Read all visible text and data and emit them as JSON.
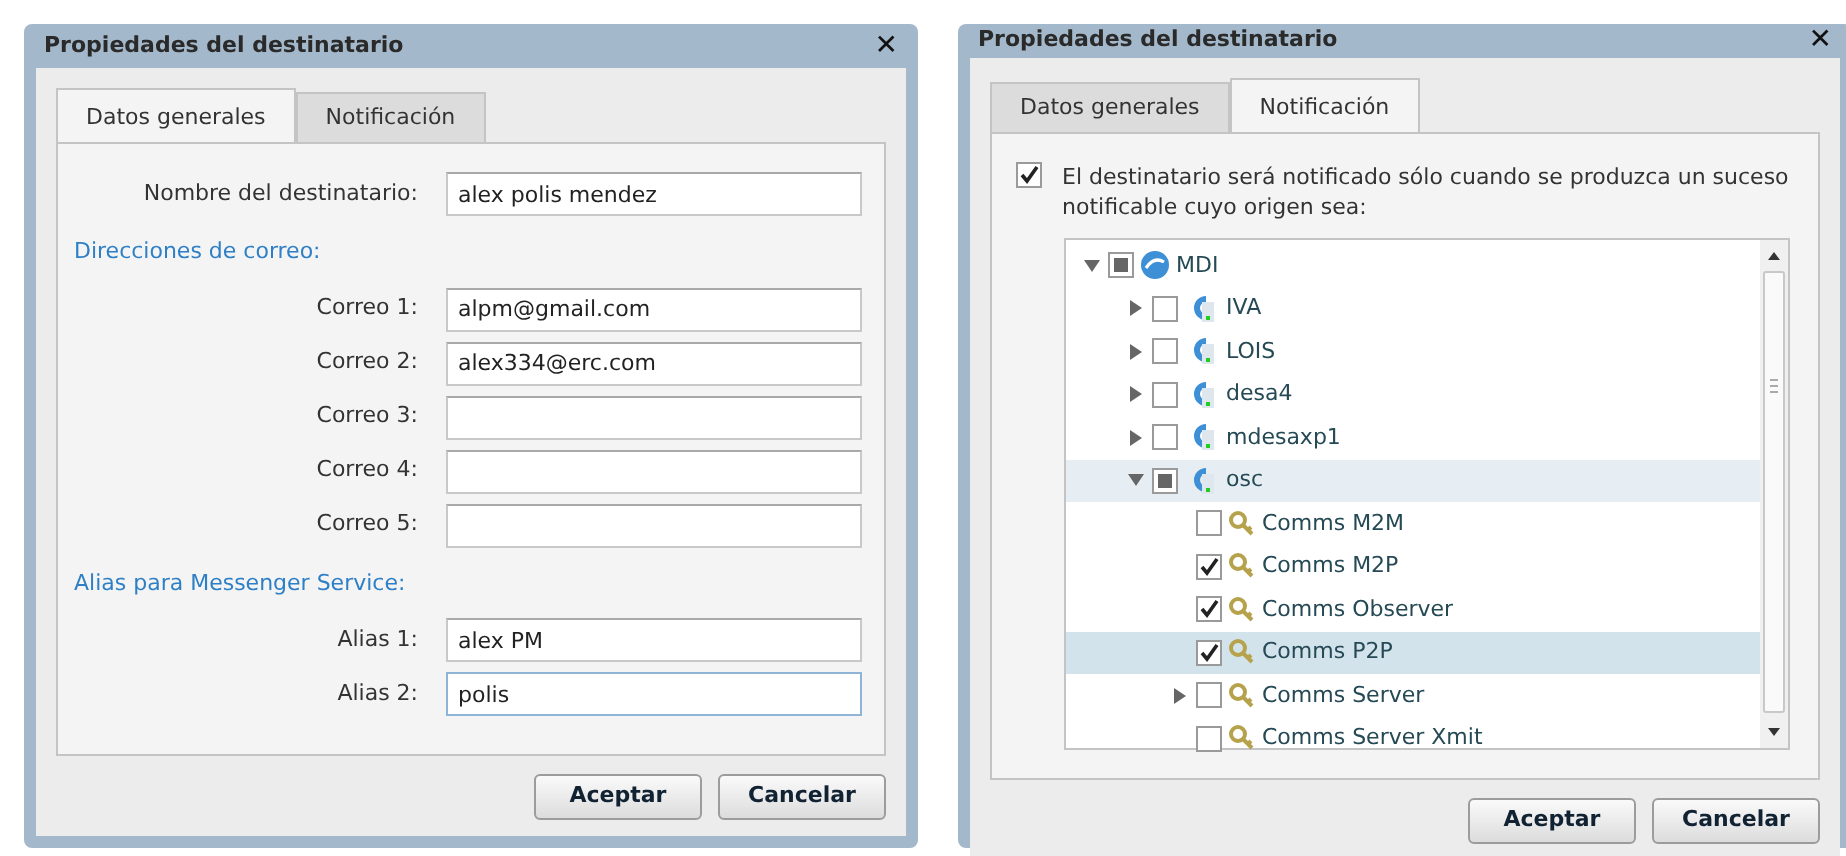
{
  "dialogs": [
    {
      "title": "Propiedades del destinatario",
      "close": "✕",
      "tabs": [
        {
          "label": "Datos generales",
          "selected": true
        },
        {
          "label": "Notificación",
          "selected": false
        }
      ],
      "form": [
        {
          "kind": "field",
          "label": "Nombre del destinatario:",
          "value": "alex polis mendez",
          "focused": false
        },
        {
          "kind": "heading",
          "label": "Direcciones de correo:"
        },
        {
          "kind": "field",
          "label": "Correo 1:",
          "value": "alpm@gmail.com",
          "focused": false
        },
        {
          "kind": "field",
          "label": "Correo 2:",
          "value": "alex334@erc.com",
          "focused": false
        },
        {
          "kind": "field",
          "label": "Correo 3:",
          "focused": false
        },
        {
          "kind": "field",
          "label": "Correo 4:",
          "focused": false
        },
        {
          "kind": "field",
          "label": "Correo 5:",
          "focused": false
        },
        {
          "kind": "heading",
          "label": "Alias para Messenger Service:"
        },
        {
          "kind": "field",
          "label": "Alias 1:",
          "value": "alex PM",
          "focused": false
        },
        {
          "kind": "field",
          "label": "Alias 2:",
          "value": "polis",
          "focused": true
        }
      ],
      "buttons": [
        "Aceptar",
        "Cancelar"
      ]
    },
    {
      "title": "Propiedades del destinatario",
      "close": "✕",
      "tabs": [
        {
          "label": "Datos generales",
          "selected": false
        },
        {
          "label": "Notificación",
          "selected": true
        }
      ],
      "notify": {
        "checked": true,
        "text": "El destinatario será notificado sólo cuando se produzca un suceso notificable cuyo origen sea:"
      },
      "tree": [
        {
          "kind": "network",
          "label": "MDI",
          "expanded": true,
          "partial": true,
          "selected": false,
          "hovered": false,
          "children": [
            {
              "kind": "host",
              "label": "IVA",
              "expanded": false,
              "checked": false,
              "selected": false,
              "hovered": false
            },
            {
              "kind": "host",
              "label": "LOIS",
              "expanded": false,
              "checked": false,
              "selected": false,
              "hovered": false
            },
            {
              "kind": "host",
              "label": "desa4",
              "expanded": false,
              "checked": false,
              "selected": false,
              "hovered": false
            },
            {
              "kind": "host",
              "label": "mdesaxp1",
              "expanded": false,
              "checked": false,
              "selected": false,
              "hovered": false
            },
            {
              "kind": "host",
              "label": "osc",
              "expanded": true,
              "partial": true,
              "selected": false,
              "hovered": true,
              "children": [
                {
                  "kind": "service",
                  "label": "Comms M2M",
                  "checked": false,
                  "selected": false,
                  "hovered": false
                },
                {
                  "kind": "service",
                  "label": "Comms M2P",
                  "checked": true,
                  "selected": false,
                  "hovered": false
                },
                {
                  "kind": "service",
                  "label": "Comms Observer",
                  "checked": true,
                  "selected": false,
                  "hovered": false
                },
                {
                  "kind": "service",
                  "label": "Comms P2P",
                  "checked": true,
                  "selected": true,
                  "hovered": false
                },
                {
                  "kind": "service",
                  "label": "Comms Server",
                  "expanded": false,
                  "checked": false,
                  "selected": false,
                  "hovered": false
                },
                {
                  "kind": "service",
                  "label": "Comms Server Xmit",
                  "checked": false,
                  "selected": false,
                  "hovered": false
                }
              ]
            }
          ]
        }
      ],
      "buttons": [
        "Aceptar",
        "Cancelar"
      ]
    }
  ]
}
